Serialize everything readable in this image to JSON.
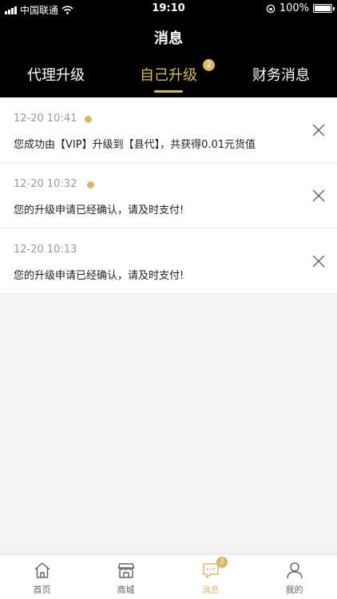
{
  "status_bar": {
    "carrier": "中国联通",
    "time": "19:10",
    "battery": "100%"
  },
  "page": {
    "title": "消息"
  },
  "tabs": [
    {
      "label": "代理升级",
      "badge": ""
    },
    {
      "label": "自己升级",
      "badge": "2"
    },
    {
      "label": "财务消息",
      "badge": ""
    }
  ],
  "messages": [
    {
      "time": "12-20 10:41",
      "unread": true,
      "text": "您成功由【VIP】升级到【县代】，共获得0.01元货值"
    },
    {
      "time": "12-20 10:32",
      "unread": true,
      "text": "您的升级申请已经确认，请及时支付!"
    },
    {
      "time": "12-20 10:13",
      "unread": false,
      "text": "您的升级申请已经确认，请及时支付!"
    }
  ],
  "tabbar": [
    {
      "label": "首页",
      "icon": "home-icon",
      "badge": ""
    },
    {
      "label": "商城",
      "icon": "store-icon",
      "badge": ""
    },
    {
      "label": "消息",
      "icon": "message-icon",
      "badge": "2"
    },
    {
      "label": "我的",
      "icon": "user-icon",
      "badge": ""
    }
  ],
  "colors": {
    "accent": "#d9b766",
    "header": "#000000"
  }
}
